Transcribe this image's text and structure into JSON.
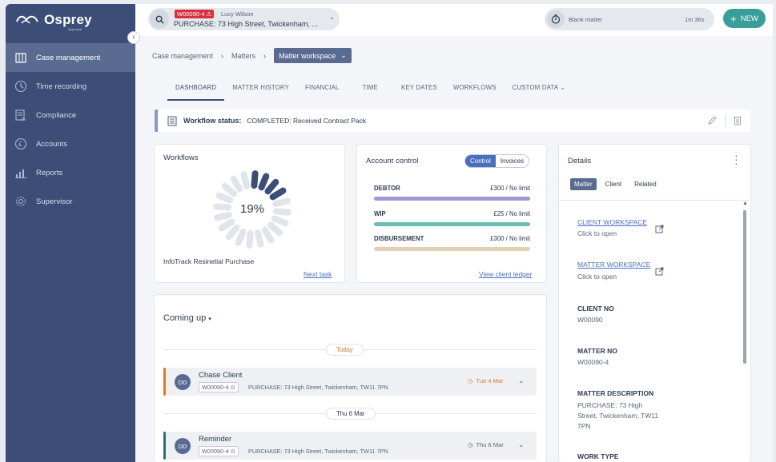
{
  "brand": {
    "name": "Osprey",
    "sub": "Approach"
  },
  "sidebar": {
    "items": [
      {
        "label": "Case management",
        "icon": "building-icon"
      },
      {
        "label": "Time recording",
        "icon": "clock-icon"
      },
      {
        "label": "Compliance",
        "icon": "compliance-icon"
      },
      {
        "label": "Accounts",
        "icon": "pound-icon"
      },
      {
        "label": "Reports",
        "icon": "chart-icon"
      },
      {
        "label": "Supervisor",
        "icon": "gear-icon"
      }
    ]
  },
  "topbar": {
    "matter_code": "W00090-4 ⚠",
    "client": "Lucy Wilson",
    "matter_title": "PURCHASE: 73 High Street, Twickenham, ...",
    "timer_label": "Blank matter",
    "timer_time": "1m 36s",
    "new_label": "NEW"
  },
  "breadcrumb": {
    "items": [
      "Case management",
      "Matters"
    ],
    "current": "Matter workspace"
  },
  "tabs": [
    "DASHBOARD",
    "MATTER HISTORY",
    "FINANCIAL",
    "TIME",
    "KEY DATES",
    "WORKFLOWS",
    "CUSTOM DATA"
  ],
  "status": {
    "label": "Workflow status:",
    "value": "COMPLETED: Received Contract Pack"
  },
  "workflows": {
    "title": "Workflows",
    "percent_text": "19%",
    "progress": 0.19,
    "name": "InfoTrack Resinetial Purchase",
    "next_task": "Next task"
  },
  "account_control": {
    "title": "Account control",
    "toggle": [
      "Control",
      "Invoices"
    ],
    "rows": [
      {
        "name": "DEBTOR",
        "limit": "£300 / No limit",
        "color": "#9f97cf"
      },
      {
        "name": "WIP",
        "limit": "£25 / No limit",
        "color": "#6cbfb0"
      },
      {
        "name": "DISBURSEMENT",
        "limit": "£300 / No limit",
        "color": "#e2cfb5"
      }
    ],
    "ledger_link": "View client ledger"
  },
  "details": {
    "title": "Details",
    "subtabs": [
      "Matter",
      "Client",
      "Related"
    ],
    "client_workspace": "CLIENT WORKSPACE",
    "matter_workspace": "MATTER WORKSPACE",
    "click_to_open": "Click to open",
    "fields": [
      {
        "label": "CLIENT NO",
        "value": "W00090"
      },
      {
        "label": "MATTER NO",
        "value": "W00090-4"
      },
      {
        "label": "MATTER DESCRIPTION",
        "value": "PURCHASE: 73 High Street, Twickenham, TW11 7PN"
      },
      {
        "label": "WORK TYPE",
        "value": ""
      }
    ]
  },
  "coming_up": {
    "title": "Coming up",
    "days": [
      "Today",
      "Thu 6 Mar"
    ],
    "events": [
      {
        "title": "Chase Client",
        "initials": "DD",
        "code": "W00090-4 ⊙",
        "desc": "PURCHASE: 73 High Street, Twickenham, TW11 7PN",
        "date": "Tue 4 Mar",
        "bar": "#e07a2c",
        "date_color": "#e07a2c"
      },
      {
        "title": "Reminder",
        "initials": "DD",
        "code": "W00090-4 ⊙",
        "desc": "PURCHASE: 73 High Street, Twickenham, TW11 7PN",
        "date": "Thu 6 Mar",
        "bar": "#2f6f73",
        "date_color": "#59657a"
      }
    ]
  }
}
